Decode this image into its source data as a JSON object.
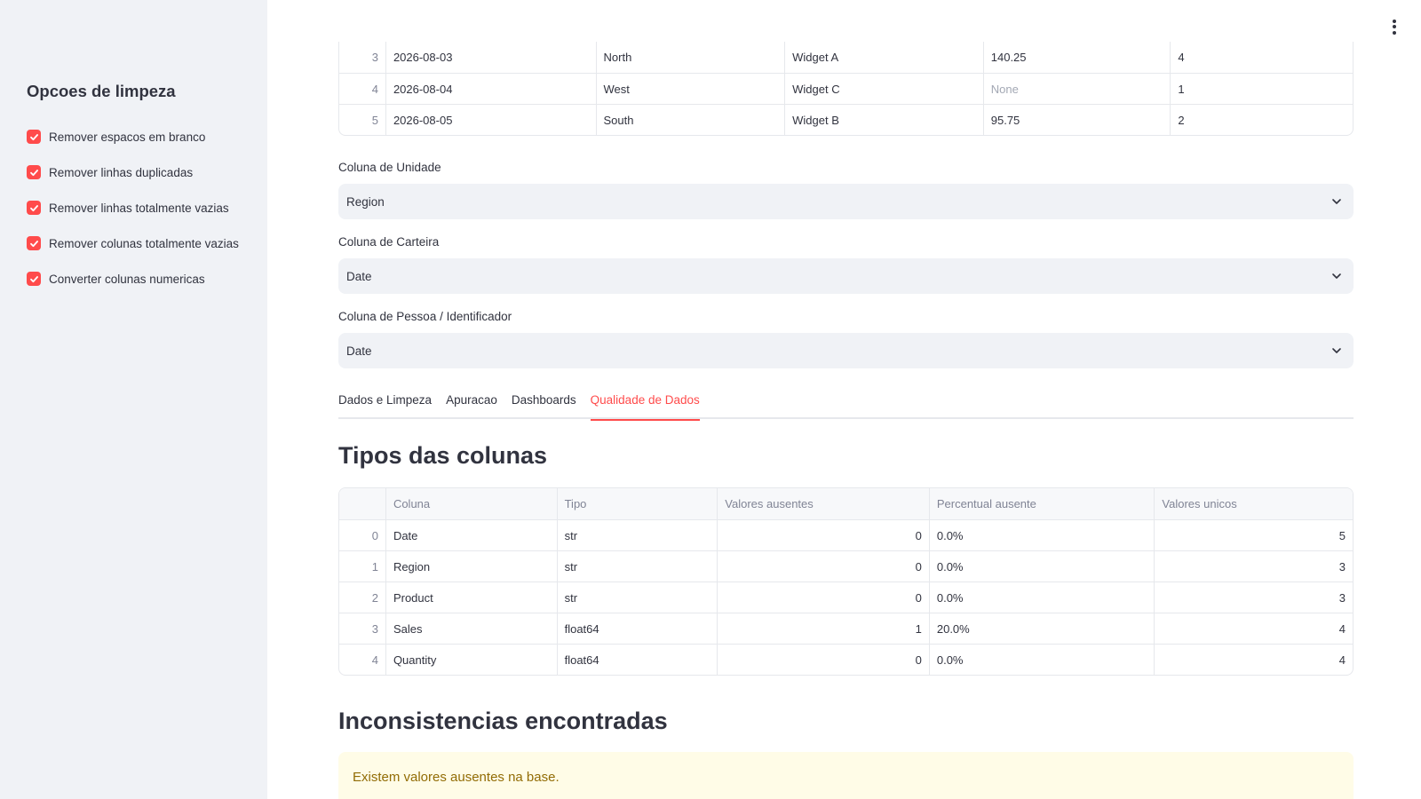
{
  "sidebar": {
    "title": "Opcoes de limpeza",
    "options": [
      {
        "label": "Remover espacos em branco",
        "checked": true
      },
      {
        "label": "Remover linhas duplicadas",
        "checked": true
      },
      {
        "label": "Remover linhas totalmente vazias",
        "checked": true
      },
      {
        "label": "Remover colunas totalmente vazias",
        "checked": true
      },
      {
        "label": "Converter colunas numericas",
        "checked": true
      }
    ]
  },
  "preview_table": {
    "rows": [
      {
        "idx": "3",
        "date": "2026-08-03",
        "region": "North",
        "product": "Widget A",
        "sales": "140.25",
        "quantity": "4"
      },
      {
        "idx": "4",
        "date": "2026-08-04",
        "region": "West",
        "product": "Widget C",
        "sales": "None",
        "quantity": "1"
      },
      {
        "idx": "5",
        "date": "2026-08-05",
        "region": "South",
        "product": "Widget B",
        "sales": "95.75",
        "quantity": "2"
      }
    ]
  },
  "selects": {
    "unidade": {
      "label": "Coluna de Unidade",
      "value": "Region"
    },
    "carteira": {
      "label": "Coluna de Carteira",
      "value": "Date"
    },
    "pessoa": {
      "label": "Coluna de Pessoa / Identificador",
      "value": "Date"
    }
  },
  "tabs": [
    {
      "label": "Dados e Limpeza",
      "active": false
    },
    {
      "label": "Apuracao",
      "active": false
    },
    {
      "label": "Dashboards",
      "active": false
    },
    {
      "label": "Qualidade de Dados",
      "active": true
    }
  ],
  "types_section": {
    "title": "Tipos das colunas",
    "headers": [
      "",
      "Coluna",
      "Tipo",
      "Valores ausentes",
      "Percentual ausente",
      "Valores unicos"
    ],
    "rows": [
      [
        "0",
        "Date",
        "str",
        "0",
        "0.0%",
        "5"
      ],
      [
        "1",
        "Region",
        "str",
        "0",
        "0.0%",
        "3"
      ],
      [
        "2",
        "Product",
        "str",
        "0",
        "0.0%",
        "3"
      ],
      [
        "3",
        "Sales",
        "float64",
        "1",
        "20.0%",
        "4"
      ],
      [
        "4",
        "Quantity",
        "float64",
        "0",
        "0.0%",
        "4"
      ]
    ]
  },
  "inconsistencies": {
    "title": "Inconsistencias encontradas",
    "warning": "Existem valores ausentes na base."
  },
  "colors": {
    "accent": "#ff4b4b",
    "sidebar_bg": "#f0f2f6",
    "warning_bg": "#fffce7",
    "warning_text": "#926c05"
  }
}
